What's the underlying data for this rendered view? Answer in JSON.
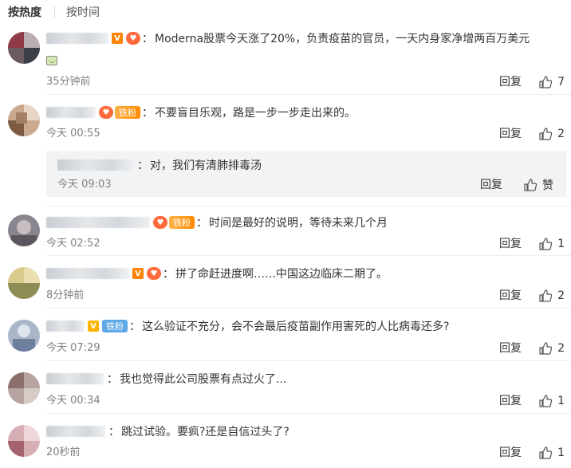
{
  "sort": {
    "hot": "按热度",
    "time": "按时间"
  },
  "reply_label": "回复",
  "like_label": "赞",
  "colors": {
    "accent": "#ff8200",
    "meta": "#808080",
    "nested_bg": "#f2f3f5"
  },
  "comments": [
    {
      "text": "Moderna股票今天涨了20%，负责疫苗的官员，一天内身家净增两百万美元",
      "emoji": "doge-emoji",
      "time": "35分钟前",
      "likes": "7",
      "badges": [
        "vip-v-icon",
        "heart-fan-icon"
      ]
    },
    {
      "text": "不要盲目乐观，路是一步一步走出来的。",
      "time": "今天 00:55",
      "likes": "2",
      "badges": [
        "heart-fan-icon",
        "tiefen-badge"
      ],
      "badge_label": "铁粉",
      "reply": {
        "text": "对，我们有清肺排毒汤",
        "time": "今天 09:03"
      }
    },
    {
      "text": "时间是最好的说明，等待未来几个月",
      "time": "今天 02:52",
      "likes": "1",
      "badges": [
        "heart-fan-icon",
        "tiefen-badge"
      ],
      "badge_label": "铁粉"
    },
    {
      "text": "拼了命赶进度啊……中国这边临床二期了。",
      "time": "8分钟前",
      "likes": "2",
      "badges": [
        "vip-v-icon",
        "heart-fan-icon"
      ]
    },
    {
      "text": "这么验证不充分，会不会最后疫苗副作用害死的人比病毒还多?",
      "time": "今天 07:29",
      "likes": "2",
      "badges": [
        "vip-v-icon",
        "tiefen-badge"
      ],
      "badge_label": "铁粉"
    },
    {
      "text": "我也觉得此公司股票有点过火了...",
      "time": "今天 00:34",
      "likes": "1",
      "badges": []
    },
    {
      "text": "跳过试验。要疯?还是自信过头了?",
      "time": "20秒前",
      "likes": "1",
      "badges": []
    }
  ]
}
